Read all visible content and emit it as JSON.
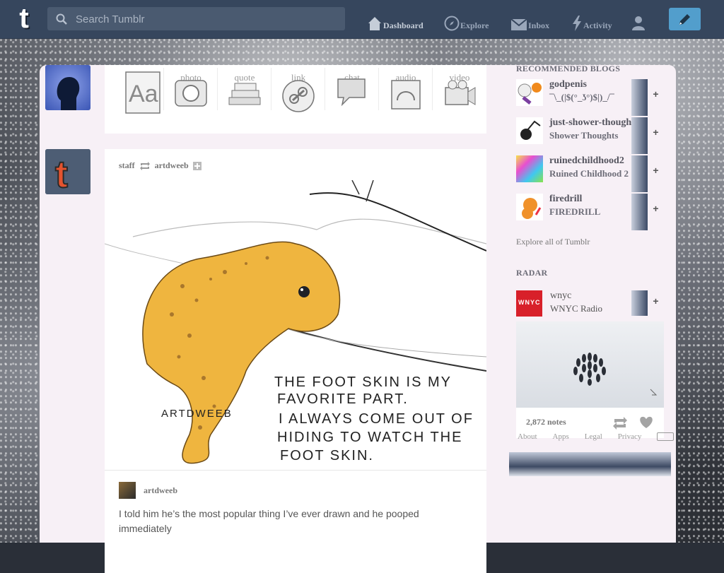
{
  "header": {
    "logo": "t",
    "search_placeholder": "Search Tumblr",
    "nav": [
      {
        "label": "Dashboard",
        "icon": "home-icon"
      },
      {
        "label": "Explore",
        "icon": "compass-icon"
      },
      {
        "label": "Inbox",
        "icon": "mail-icon"
      },
      {
        "label": "Activity",
        "icon": "lightning-icon"
      },
      {
        "label": "",
        "icon": "account-icon"
      }
    ],
    "compose_icon": "pencil-icon"
  },
  "post_types": [
    {
      "label": "text",
      "icon": "text-aa-icon"
    },
    {
      "label": "photo",
      "icon": "camera-icon"
    },
    {
      "label": "quote",
      "icon": "quote-books-icon"
    },
    {
      "label": "link",
      "icon": "link-icon"
    },
    {
      "label": "chat",
      "icon": "chat-icon"
    },
    {
      "label": "audio",
      "icon": "headphones-icon"
    },
    {
      "label": "video",
      "icon": "video-camera-icon"
    }
  ],
  "post": {
    "reblogger": "staff",
    "source": "artdweeb",
    "image_text": {
      "signature": "ARTDWEEB",
      "line1": "THE FOOT SKIN IS MY",
      "line2": "FAVORITE PART.",
      "line3": "I ALWAYS COME OUT OF",
      "line4": "HIDING TO WATCH THE",
      "line5": "FOOT SKIN."
    },
    "caption_user": "artdweeb",
    "caption": "I told him he’s the most popular thing I’ve ever drawn and he pooped immediately"
  },
  "sidebar": {
    "recommended_title": "RECOMMENDED BLOGS",
    "blogs": [
      {
        "name": "godpenis",
        "subtitle": "¯\\_(|$(°_ʖ°)$|)_/¯"
      },
      {
        "name": "just-shower-thoughts",
        "subtitle": "Shower Thoughts"
      },
      {
        "name": "ruinedchildhood2",
        "subtitle": "Ruined Childhood 2"
      },
      {
        "name": "firedrill",
        "subtitle": "FIREDRILL"
      }
    ],
    "follow_label": "+",
    "explore_link": "Explore all of Tumblr",
    "radar_title": "RADAR",
    "radar": {
      "name": "wnyc",
      "subtitle": "WNYC Radio",
      "avatar_text": "WNYC",
      "notes": "2,872 notes"
    },
    "footer_links": [
      "About",
      "Apps",
      "Legal",
      "Privacy"
    ]
  },
  "colors": {
    "header": "#36465d",
    "compose": "#529ecc",
    "dashboard_bg": "#f7f0f6"
  }
}
